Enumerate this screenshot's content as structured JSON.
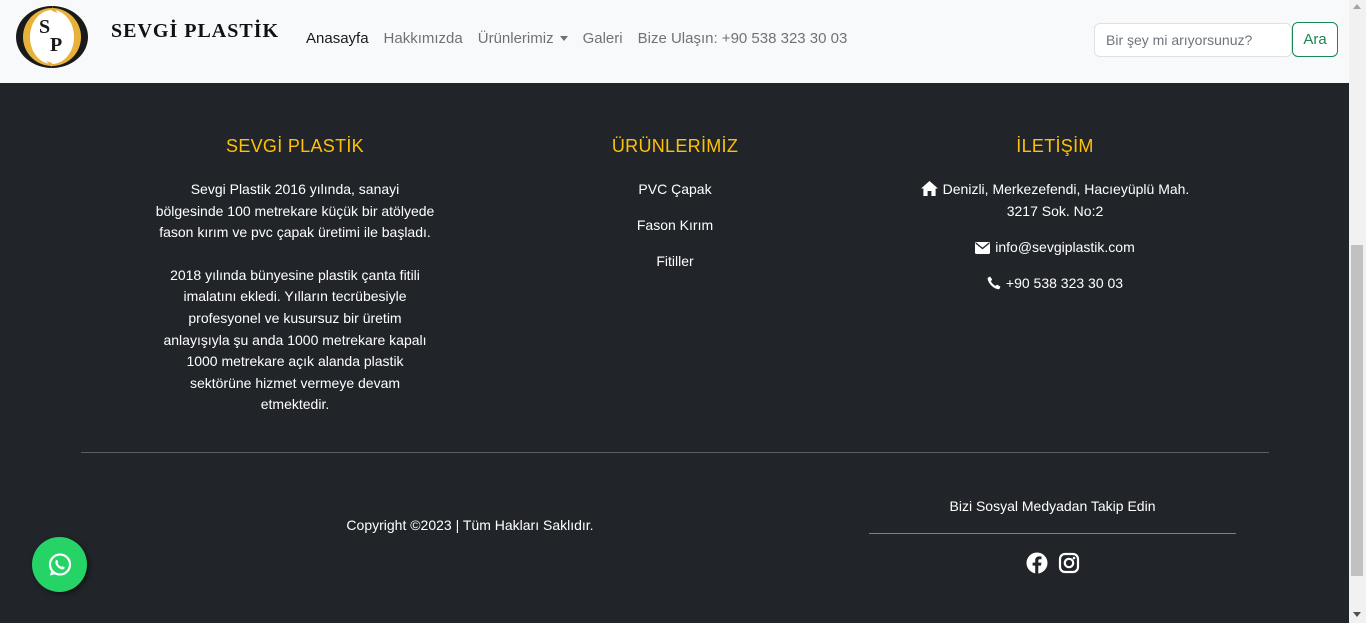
{
  "brand": {
    "name": "SEVGİ  PLASTİK",
    "logo_letters": "S P"
  },
  "nav": {
    "items": [
      {
        "label": "Anasayfa",
        "active": true
      },
      {
        "label": "Hakkımızda"
      },
      {
        "label": "Ürünlerimiz",
        "dropdown": true
      },
      {
        "label": "Galeri"
      },
      {
        "label": "Bize Ulaşın: +90 538 323 30 03"
      }
    ]
  },
  "search": {
    "placeholder": "Bir şey mi arıyorsunuz?",
    "button_label": "Ara"
  },
  "footer": {
    "about": {
      "title": "SEVGİ PLASTİK",
      "p1": "Sevgi Plastik 2016 yılında, sanayi bölgesinde 100 metrekare küçük bir atölyede fason kırım ve pvc çapak üretimi ile başladı.",
      "p2": "2018 yılında bünyesine plastik çanta fitili imalatını ekledi. Yılların tecrübesiyle profesyonel ve kusursuz bir üretim anlayışıyla şu anda 1000 metrekare kapalı 1000 metrekare açık alanda plastik sektörüne hizmet vermeye devam etmektedir."
    },
    "products": {
      "title": "ÜRÜNLERİMİZ",
      "items": [
        "PVC Çapak",
        "Fason Kırım",
        "Fitiller"
      ]
    },
    "contact": {
      "title": "İLETİŞİM",
      "address": "Denizli, Merkezefendi, Hacıeyüplü Mah. 3217 Sok. No:2",
      "email": "info@sevgiplastik.com",
      "phone": "+90 538 323 30 03"
    },
    "copyright": "Copyright ©2023 | Tüm Hakları Saklıdır.",
    "social_title": "Bizi Sosyal Medyadan Takip Edin"
  },
  "colors": {
    "accent": "#ffc107",
    "footer_bg": "#212529",
    "navbar_bg": "#f8f9fa",
    "search_button": "#198754",
    "whatsapp": "#25d366"
  },
  "icons": [
    "home-icon",
    "envelope-icon",
    "phone-icon",
    "facebook-icon",
    "instagram-icon",
    "whatsapp-icon"
  ]
}
